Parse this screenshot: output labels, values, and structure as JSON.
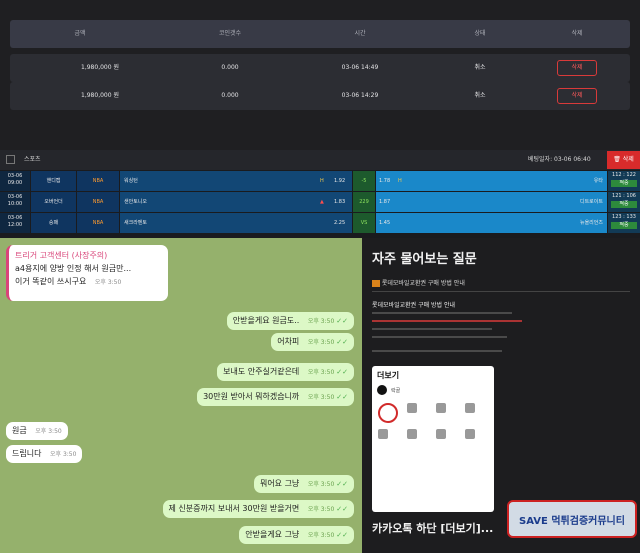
{
  "history": {
    "headers": [
      "금액",
      "코인갯수",
      "시간",
      "상태",
      "삭제"
    ],
    "rows": [
      {
        "amount": "1,980,000 원",
        "coins": "0.000",
        "time": "03-06 14:49",
        "status": "취소",
        "delete_label": "삭제"
      },
      {
        "amount": "1,980,000 원",
        "coins": "0.000",
        "time": "03-06 14:29",
        "status": "취소",
        "delete_label": "삭제"
      }
    ]
  },
  "slip": {
    "sport_label": "스포츠",
    "bet_date": "베팅일자: 03-06 06:40",
    "delete_label": "삭제",
    "rows": [
      {
        "date": "03-06",
        "time": "09:00",
        "type": "핸디캡",
        "league": "NBA",
        "home": "워싱턴",
        "home_mark": "H",
        "home_odds": "1.92",
        "mid": "-5",
        "away_odds": "1.78",
        "away_mark": "H",
        "away": "유타",
        "score": "112 : 122",
        "result": "적중"
      },
      {
        "date": "03-06",
        "time": "10:00",
        "type": "오버언더",
        "league": "NBA",
        "home": "샌안토니오",
        "home_mark": "▲",
        "home_odds": "1.83",
        "mid": "229",
        "away_odds": "1.87",
        "away_mark": "",
        "away": "디트로이트",
        "score": "121 : 106",
        "result": "적중"
      },
      {
        "date": "03-06",
        "time": "12:00",
        "type": "승패",
        "league": "NBA",
        "home": "새크라멘토",
        "home_mark": "",
        "home_odds": "2.25",
        "mid": "VS",
        "away_odds": "1.45",
        "away_mark": "",
        "away": "뉴올리언즈",
        "score": "123 : 133",
        "result": "적중"
      }
    ]
  },
  "chat": {
    "header_line": "트리거 고객센터 (사장주의)",
    "first_msg": "a4용지에  양방 인정 해서 원금만...",
    "first_reply": "이거 똑같이 쓰시구요",
    "first_time": "오후 3:50",
    "messages": [
      {
        "text": "안받을게요 원금도..",
        "time": "오후 3:50",
        "side": "out"
      },
      {
        "text": "어차피",
        "time": "오후 3:50",
        "side": "out"
      },
      {
        "text": "보내도 안주실거같은데",
        "time": "오후 3:50",
        "side": "out"
      },
      {
        "text": "30만원 받아서 뭐하겠습니까",
        "time": "오후 3:50",
        "side": "out"
      },
      {
        "text": "원금",
        "time": "오후 3:50",
        "side": "in"
      },
      {
        "text": "드립니다",
        "time": "오후 3:50",
        "side": "in"
      },
      {
        "text": "뭐어요 그냥",
        "time": "오후 3:50",
        "side": "out"
      },
      {
        "text": "제 신분증까지 보내서 30만원 받을거면",
        "time": "오후 3:50",
        "side": "out"
      },
      {
        "text": "안받을게요 그냥",
        "time": "오후 3:50",
        "side": "out"
      }
    ]
  },
  "faq": {
    "title": "자주 물어보는 질문",
    "item_label": "롯데모바일교환권 구매 방법 안내",
    "box_title": "롯데모바일교환권 구매 방법 안내",
    "phone_header": "더보기",
    "phone_sub": "락골",
    "caption": "카카오톡 하단 [더보기]...",
    "watermark": "SAVE 먹튀검증커뮤니티"
  }
}
